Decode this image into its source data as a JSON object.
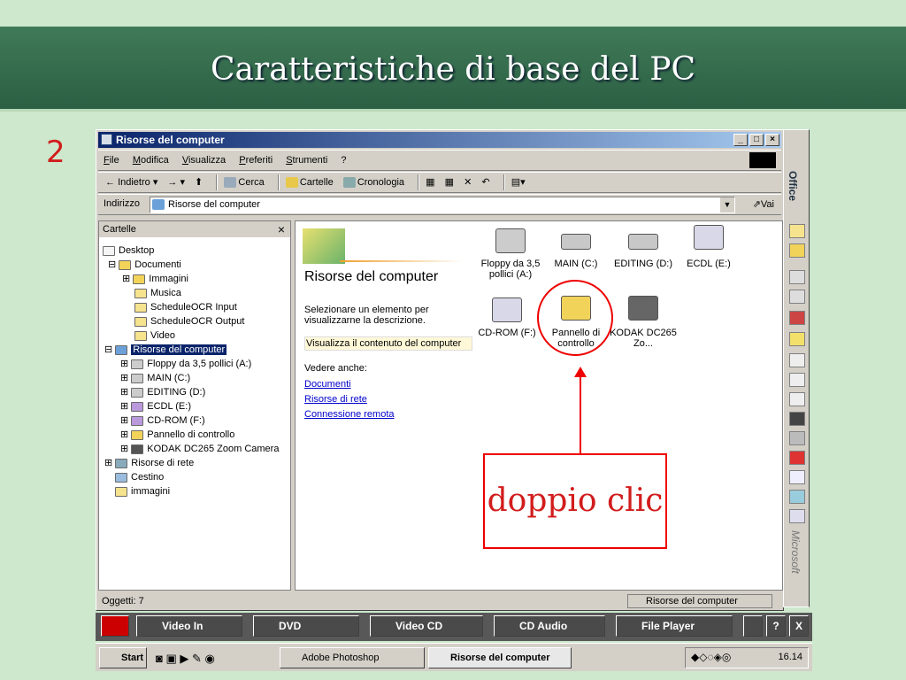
{
  "slide": {
    "title": "Caratteristiche di base del PC",
    "number": "2",
    "callout": "doppio clic"
  },
  "window": {
    "title": "Risorse del computer",
    "minimize": "_",
    "maximize": "□",
    "close": "×"
  },
  "menu": [
    "File",
    "Modifica",
    "Visualizza",
    "Preferiti",
    "Strumenti",
    "?"
  ],
  "toolbar": {
    "back": "Indietro",
    "search": "Cerca",
    "folders": "Cartelle",
    "history": "Cronologia"
  },
  "address": {
    "label": "Indirizzo",
    "value": "Risorse del computer",
    "go": "Vai"
  },
  "folders_pane": {
    "title": "Cartelle",
    "close": "×",
    "items": [
      "Desktop",
      "Documenti",
      "Immagini",
      "Musica",
      "ScheduleOCR Input",
      "ScheduleOCR Output",
      "Video",
      "Risorse del computer",
      "Floppy da 3,5 pollici (A:)",
      "MAIN (C:)",
      "EDITING (D:)",
      "ECDL (E:)",
      "CD-ROM (F:)",
      "Pannello di controllo",
      "KODAK DC265 Zoom Camera",
      "Risorse di rete",
      "Cestino",
      "immagini"
    ]
  },
  "content": {
    "heading": "Risorse del computer",
    "description": "Selezionare un elemento per visualizzarne la descrizione.",
    "view_contents": "Visualizza il contenuto del computer",
    "see_also": "Vedere anche:",
    "links": [
      "Documenti",
      "Risorse di rete",
      "Connessione remota"
    ],
    "icons": [
      "Floppy da 3,5 pollici (A:)",
      "MAIN (C:)",
      "EDITING (D:)",
      "ECDL (E:)",
      "CD-ROM (F:)",
      "Pannello di controllo",
      "KODAK DC265 Zo..."
    ]
  },
  "status": {
    "objects": "Oggetti: 7",
    "location": "Risorse del computer"
  },
  "office_bar": {
    "top": "Office",
    "bottom": "Microsoft"
  },
  "media_bar": {
    "items": [
      "Video In",
      "DVD",
      "Video CD",
      "CD Audio",
      "File Player"
    ],
    "help": "?",
    "close": "X"
  },
  "taskbar": {
    "start": "Start",
    "tasks": [
      "Adobe Photoshop",
      "Risorse del computer"
    ],
    "clock": "16.14"
  }
}
